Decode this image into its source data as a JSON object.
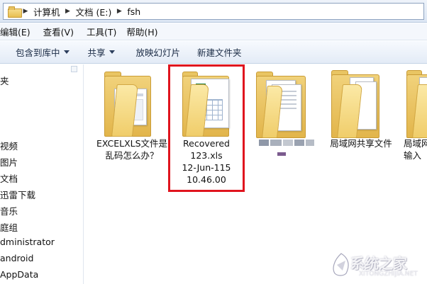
{
  "address_bar": {
    "breadcrumbs": [
      "计算机",
      "文档 (E:)",
      "fsh"
    ]
  },
  "menu": {
    "items": [
      "编辑(E)",
      "查看(V)",
      "工具(T)",
      "帮助(H)"
    ]
  },
  "toolbar": {
    "include_in_library": "包含到库中",
    "share": "共享",
    "slideshow": "放映幻灯片",
    "new_folder": "新建文件夹"
  },
  "nav_pane": {
    "items": [
      "夹",
      "视频",
      "图片",
      "文档",
      "迅雷下载",
      "音乐",
      "庭组",
      "dministrator",
      "android",
      "AppData"
    ]
  },
  "files": [
    {
      "label_lines": [
        "EXCELXLS文件是",
        "乱码怎么办？"
      ],
      "icon": "folder-with-document-icon"
    },
    {
      "label_lines": [
        "Recovered",
        "123.xls",
        "12-Jun-115",
        "10.46.00"
      ],
      "icon": "excel-file-icon",
      "highlighted": true
    },
    {
      "label_lines": [],
      "icon": "folder-with-papers-icon",
      "blurred": true
    },
    {
      "label_lines": [
        "局域网共享文件"
      ],
      "icon": "folder-with-files-icon"
    },
    {
      "label_lines": [
        "局域网",
        "输入"
      ],
      "icon": "folder-icon"
    }
  ],
  "colors": {
    "highlight": "#e0141e",
    "excel_green": "#1d7a3b",
    "folder": "#f0cd6a"
  },
  "watermark": {
    "text": "系统之家",
    "sub": "XITONGZHIJIA.NET"
  }
}
